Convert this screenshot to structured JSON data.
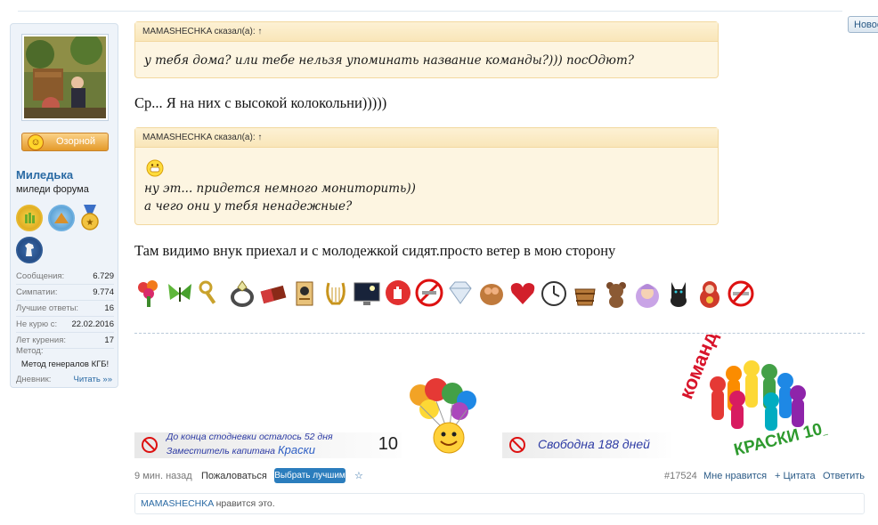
{
  "header": {
    "new_button": "Новое"
  },
  "sidebar": {
    "mood_label": "Озорной",
    "username": "Миледька",
    "user_title": "миледи форума",
    "stats": [
      {
        "key": "Сообщения:",
        "value": "6.729"
      },
      {
        "key": "Симпатии:",
        "value": "9.774"
      },
      {
        "key": "Лучшие ответы:",
        "value": "16"
      },
      {
        "key": "Не курю с:",
        "value": "22.02.2016"
      },
      {
        "key": "Лет курения:",
        "value": "17"
      }
    ],
    "method_label": "Метод:",
    "method_value": "Метод генералов КГБ!",
    "diary_label": "Дневник:",
    "diary_link": "Читать »»"
  },
  "post": {
    "quote1": {
      "author": "MAMASHECHKA сказал(а): ↑",
      "text": "у тебя дома? или тебе нельзя упоминать название команды?))) посОдют?"
    },
    "reply1": "Ср... Я на них с высокой колокольни)))))",
    "quote2": {
      "author": "MAMASHECHKA сказал(а): ↑",
      "line1": "ну эт... придется немного мониторить))",
      "line2": "а чего они у тебя ненадежные?"
    },
    "reply2": "Там видимо внук приехал и с молодежкой сидят.просто ветер в мою сторону",
    "smileys": [
      "bouquet-icon",
      "butterfly-icon",
      "keys-icon",
      "ring-icon",
      "chocolate-icon",
      "scroll-icon",
      "lyre-icon",
      "night-monitor-icon",
      "stop-hand-icon",
      "no-smoking-badge-icon",
      "diamond-icon",
      "basket-icon",
      "heart-icon",
      "clock-icon",
      "bucket-icon",
      "bear-icon",
      "grandma-icon",
      "cat-icon",
      "matryoshka-icon",
      "no-smoking-icon"
    ]
  },
  "signature": {
    "bar1_line1": "До конца стодневки осталось 52 дня",
    "bar1_line2": "Заместитель капитана",
    "bar1_team": "Краски",
    "bar1_number": "10",
    "bar2_text": "Свободна 188 дней",
    "team_title": "команда",
    "team_sub": "КРАСКИ 10_3"
  },
  "footer": {
    "time": "9 мин. назад",
    "report": "Пожаловаться",
    "best_button": "Выбрать лучшим",
    "star": "☆",
    "post_id": "#17524",
    "like": "Мне нравится",
    "quote": "+ Цитата",
    "reply": "Ответить"
  },
  "likes": {
    "user": "MAMASHECHKA",
    "text": " нравится это."
  },
  "colors": {
    "accent": "#2b7dbd",
    "quote_bg": "#fdf5e1",
    "sidebar_bg": "#eef3f9"
  }
}
